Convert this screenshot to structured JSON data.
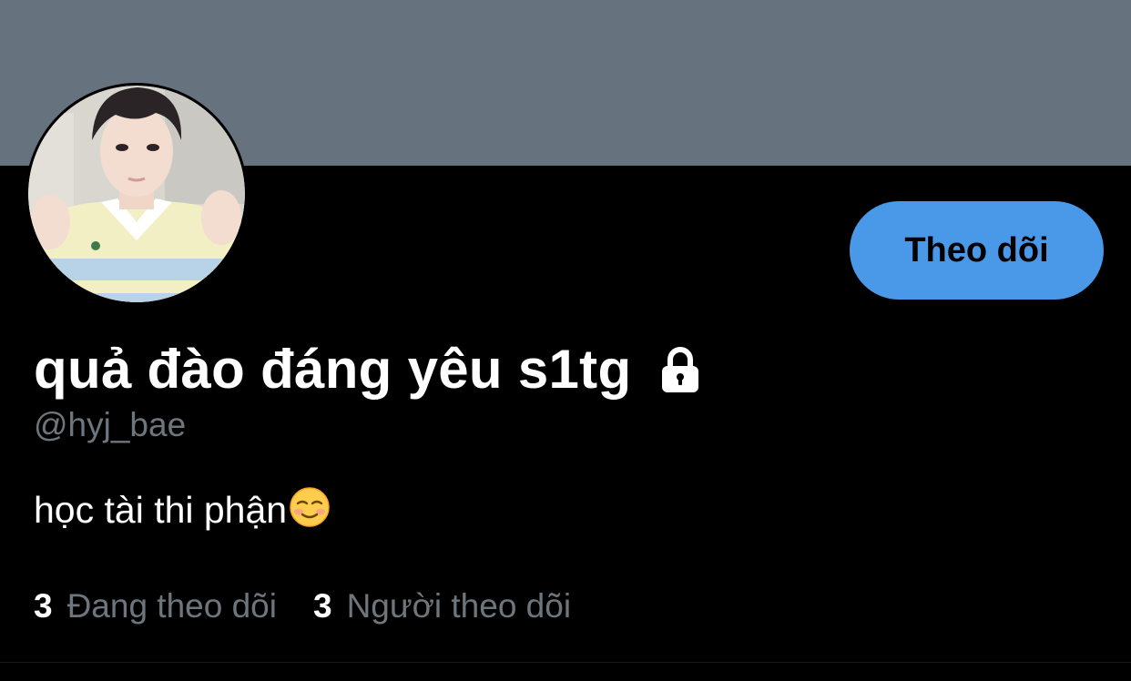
{
  "profile": {
    "display_name": "quả đào đáng yêu s1tg",
    "handle": "@hyj_bae",
    "bio": "học tài thi phận",
    "bio_emoji": "smiling-face-emoji",
    "protected_icon": "lock-icon"
  },
  "actions": {
    "follow_label": "Theo dõi"
  },
  "stats": {
    "following_count": "3",
    "following_label": "Đang theo dõi",
    "followers_count": "3",
    "followers_label": "Người theo dõi"
  },
  "colors": {
    "banner": "#66737f",
    "background": "#000000",
    "accent": "#4a99e9",
    "secondary_text": "#6e767d"
  }
}
